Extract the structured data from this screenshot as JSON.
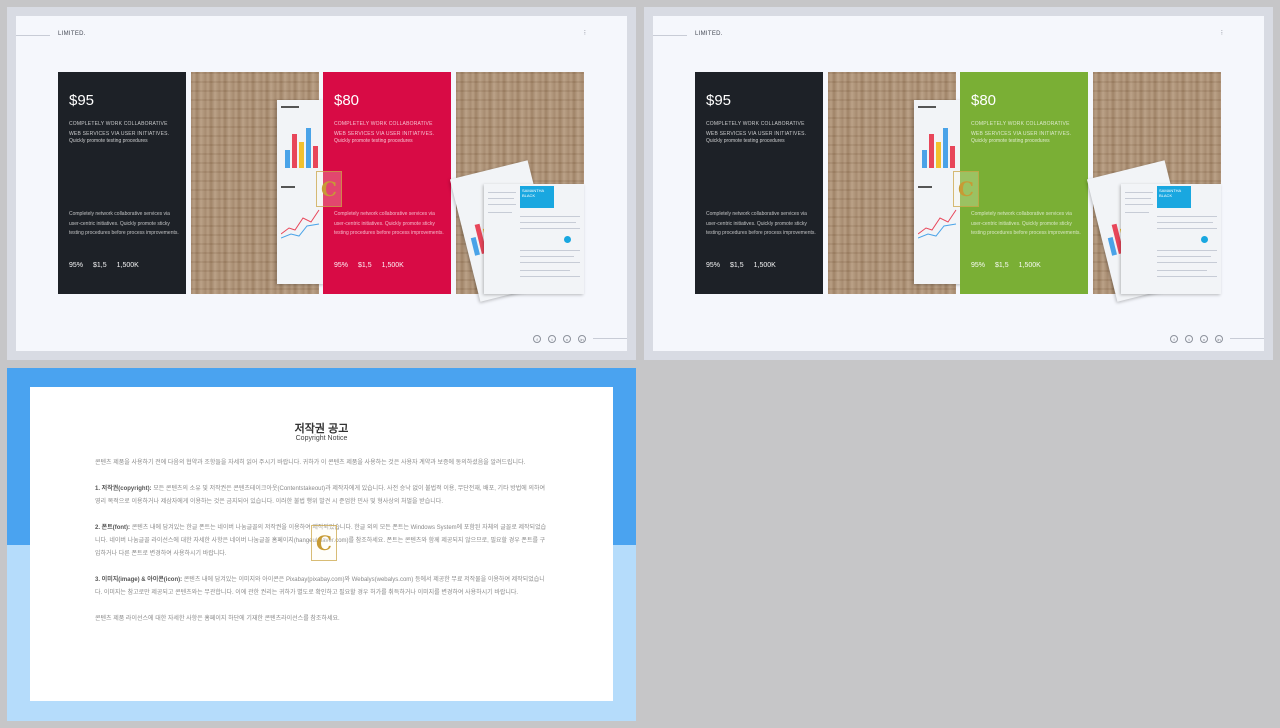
{
  "slides": [
    {
      "brand": "LIMITED.",
      "dots": "⁝",
      "cards": [
        {
          "kind": "price",
          "color": "#1d2127",
          "price": "$95",
          "sub": "COMPLETELY WORK COLLABORATIVE WEB SERVICES VIA USER INITIATIVES.",
          "sub2": "Quickly promote testing procedures",
          "desc": "Completely network collaborative services via user-centric initiatives. Quickly promote sticky testing procedures before process improvements.",
          "stats": [
            "95%",
            "$1,5",
            "1,500K"
          ]
        },
        {
          "kind": "photo"
        },
        {
          "kind": "price",
          "color": "#d80b45",
          "price": "$80",
          "sub": "COMPLETELY WORK COLLABORATIVE WEB SERVICES VIA USER INITIATIVES.",
          "sub2": "Quickly promote testing procedures",
          "desc": "Completely network collaborative services via user-centric initiatives. Quickly promote sticky testing procedures before process improvements.",
          "stats": [
            "95%",
            "$1,5",
            "1,500K"
          ]
        },
        {
          "kind": "photo"
        }
      ],
      "social": [
        "f",
        "t",
        "v",
        "in"
      ]
    },
    {
      "brand": "LIMITED.",
      "dots": "⁝",
      "cards": [
        {
          "kind": "price",
          "color": "#1d2127",
          "price": "$95",
          "sub": "COMPLETELY WORK COLLABORATIVE WEB SERVICES VIA USER INITIATIVES.",
          "sub2": "Quickly promote testing procedures",
          "desc": "Completely network collaborative services via user-centric initiatives. Quickly promote sticky testing procedures before process improvements.",
          "stats": [
            "95%",
            "$1,5",
            "1,500K"
          ]
        },
        {
          "kind": "photo"
        },
        {
          "kind": "price",
          "color": "#7aaf35",
          "price": "$80",
          "sub": "COMPLETELY WORK COLLABORATIVE WEB SERVICES VIA USER INITIATIVES.",
          "sub2": "Quickly promote testing procedures",
          "desc": "Completely network collaborative services via user-centric initiatives. Quickly promote sticky testing procedures before process improvements.",
          "stats": [
            "95%",
            "$1,5",
            "1,500K"
          ]
        },
        {
          "kind": "photo"
        }
      ],
      "social": [
        "f",
        "t",
        "v",
        "in"
      ]
    }
  ],
  "photo_text": {
    "resume_name": "SAMANTHA BLACK"
  },
  "notice": {
    "title": "저작권 공고",
    "subtitle": "Copyright Notice",
    "intro": "콘텐츠 제품을 사용하기 전에 다음의 협약과 조항들을 자세히 읽어 주시기 바랍니다. 귀하가 이 콘텐츠 제품을 사용하는 것은 사용자 계약과 보증에 동의하셨음을 알려드립니다.",
    "s1_head": "1. 저작권(copyright):",
    "s1_body": " 모든 콘텐츠의 소유 및 저작권은 콘텐츠테이크아웃(Contentstakeout)과 제작자에게 있습니다. 사전 승낙 없이 불법적 이용, 무단전재, 배포, 기타 방법에 의하여 영리 목적으로 이용하거나 제삼자에게 이용하는 것은 금지되어 있습니다. 이러한 불법 행위 발견 시 준엄한 민사 및 형사상의 처벌을 받습니다.",
    "s2_head": "2. 폰트(font):",
    "s2_body": " 콘텐츠 내에 담겨있는 한글 폰트는 네이버 나눔글꼴의 저작권을 이용하여 제작되었습니다. 한글 외의 모든 폰트는 Windows System에 포함된 자체의 글꼴로 제작되었습니다. 네이버 나눔글꼴 라이선스에 대한 자세한 사항은 네이버 나눔글꼴 홈페이지(hangeul.naver.com)를 참조하세요. 폰트는 콘텐츠와 함께 제공되지 않으므로, 필요할 경우 폰트를 구입하거나 다른 폰트로 변경하여 사용하시기 바랍니다.",
    "s3_head": "3. 이미지(image) & 아이콘(icon):",
    "s3_body": " 콘텐츠 내에 담겨있는 이미지와 아이콘은 Pixabay(pixabay.com)와 Webalys(webalys.com) 등에서 제공한 무료 저작물을 이용하여 제작되었습니다. 이미지는 참고로만 제공되고 콘텐츠와는 무관합니다. 이에 관한 권리는 귀하가 별도로 확인하고 필요할 경우 허가를 취득하거나 이미지를 변경하여 사용하시기 바랍니다.",
    "outro": "콘텐츠 제품 라이선스에 대한 자세한 사항은 홈페이지 하단에 기재한 콘텐츠라이선스를 참조하세요."
  },
  "logo_letter": "C"
}
